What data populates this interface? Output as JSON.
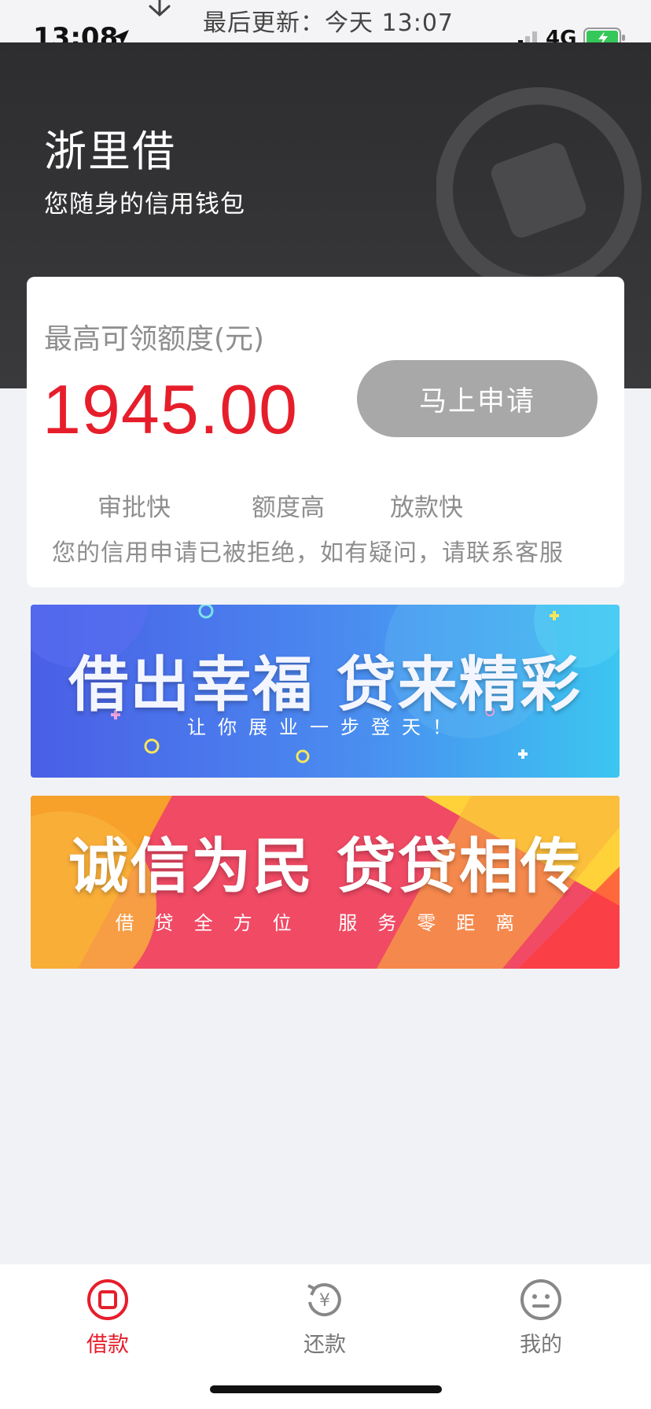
{
  "refresh": {
    "text": "最后更新：今天 13:07",
    "icon": "arrow-down-icon"
  },
  "status_bar": {
    "time": "13:08",
    "network": "4G",
    "icons": [
      "location-arrow-icon",
      "signal-icon",
      "battery-charging-icon"
    ]
  },
  "header": {
    "title": "浙里借",
    "subtitle": "您随身的信用钱包",
    "background": "#2d2d2f"
  },
  "credit_card": {
    "label": "最高可领额度(元)",
    "amount": "1945.00",
    "apply_button": "马上申请",
    "features": [
      "审批快",
      "额度高",
      "放款快"
    ],
    "notice": "您的信用申请已被拒绝，如有疑问，请联系客服"
  },
  "banners": [
    {
      "headline": "借出幸福 贷来精彩",
      "tagline": "让你展业一步登天！"
    },
    {
      "headline": "诚信为民 贷贷相传",
      "tagline": "借贷全方位 服务零距离"
    }
  ],
  "tab_bar": {
    "items": [
      {
        "label": "借款",
        "icon": "borrow-icon",
        "active": true
      },
      {
        "label": "还款",
        "icon": "repay-icon",
        "active": false
      },
      {
        "label": "我的",
        "icon": "profile-icon",
        "active": false
      }
    ]
  },
  "colors": {
    "accent": "#e61e2b",
    "button_disabled": "#a8a8a8",
    "page_background": "#f1f2f6"
  }
}
